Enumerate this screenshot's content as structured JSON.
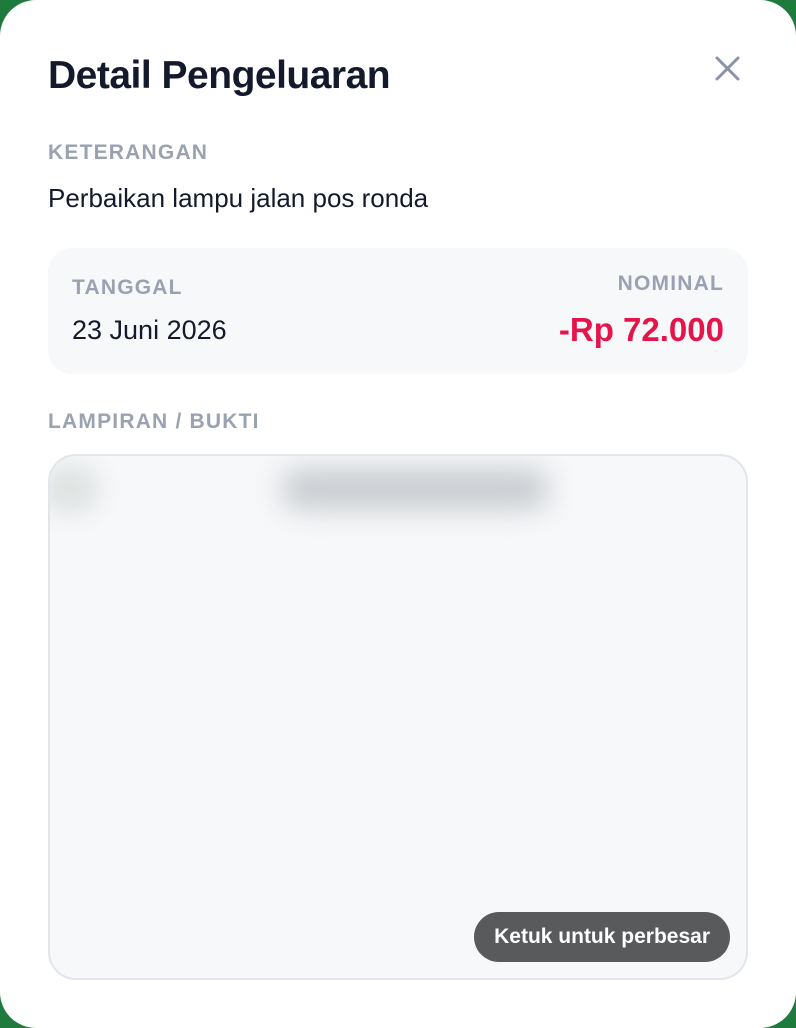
{
  "modal": {
    "title": "Detail Pengeluaran",
    "close_icon": "close-icon"
  },
  "description": {
    "label": "KETERANGAN",
    "text": "Perbaikan lampu jalan pos ronda"
  },
  "info": {
    "date_label": "TANGGAL",
    "date_value": "23 Juni 2026",
    "amount_label": "NOMINAL",
    "amount_value": "-Rp 72.000",
    "amount_color": "#e5154b"
  },
  "attachment": {
    "label": "LAMPIRAN / BUKTI",
    "hint": "Ketuk untuk perbesar"
  }
}
